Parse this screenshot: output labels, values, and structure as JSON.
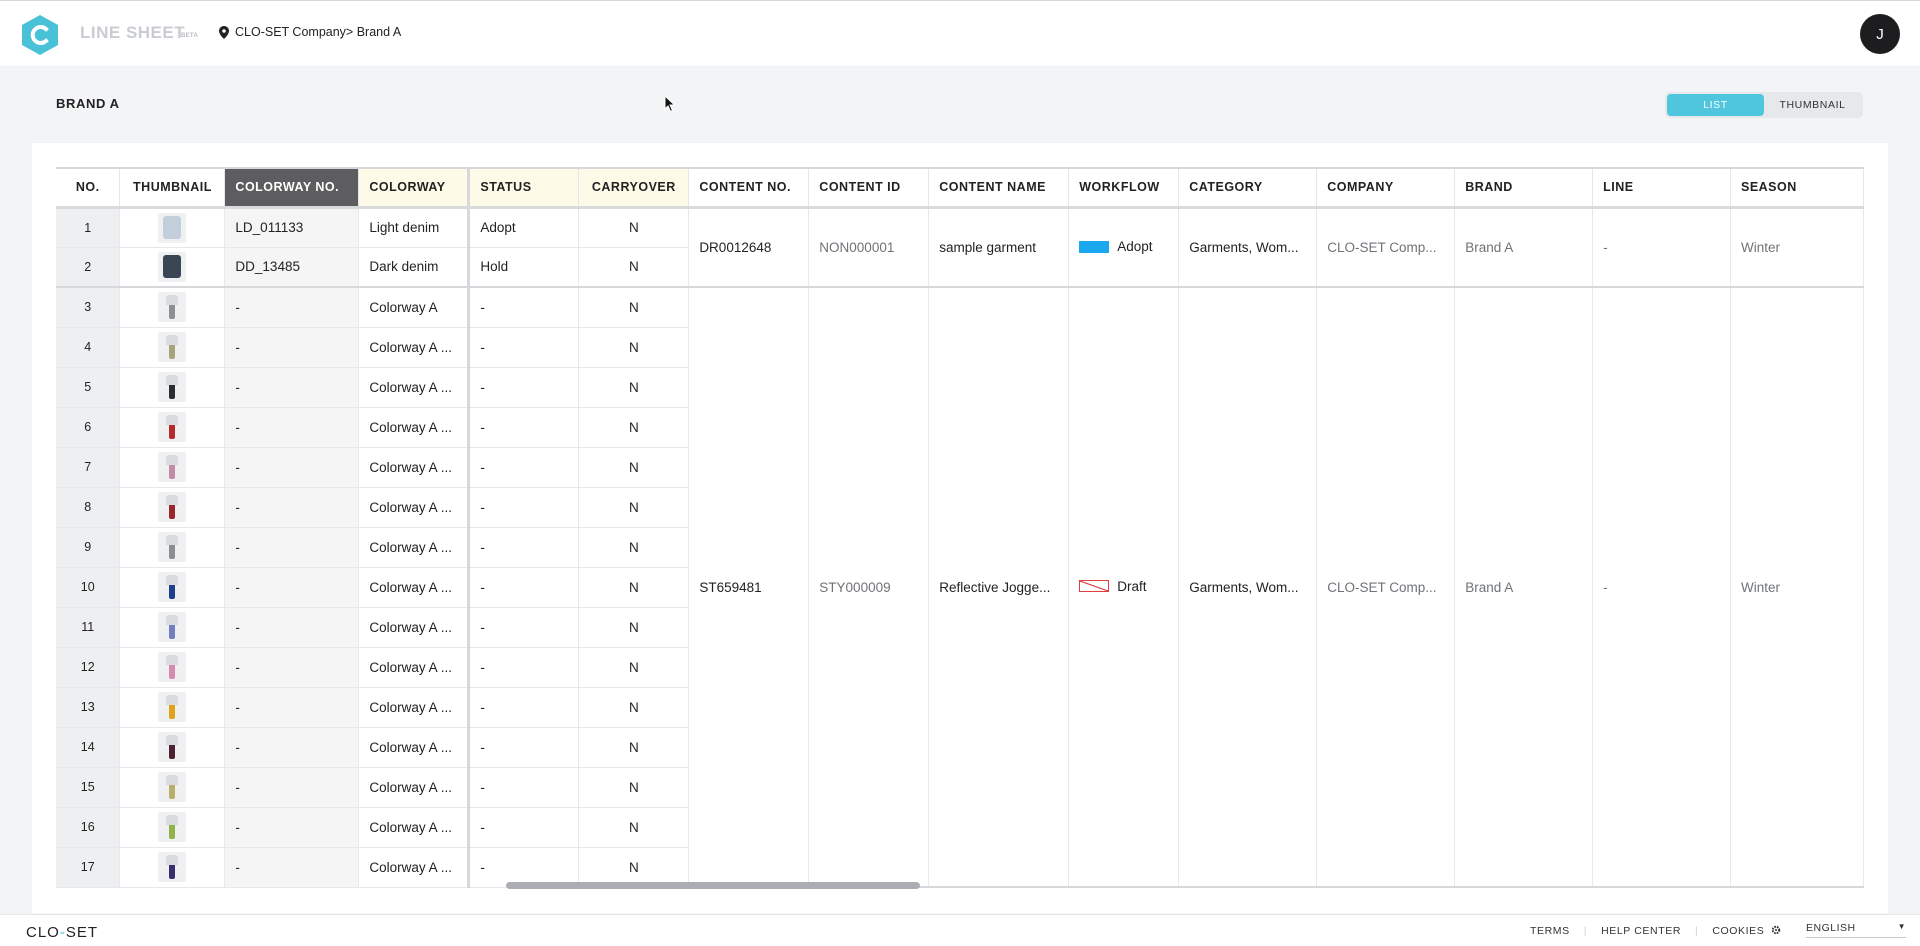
{
  "header": {
    "app_title": "LINE SHEET",
    "app_badge": "BETA",
    "breadcrumb": "CLO-SET Company> Brand A",
    "avatar_initial": "J"
  },
  "page": {
    "title": "BRAND A",
    "view_toggle": {
      "list": "LIST",
      "thumbnail": "THUMBNAIL",
      "selected": "LIST"
    }
  },
  "table": {
    "columns": [
      "NO.",
      "THUMBNAIL",
      "COLORWAY NO.",
      "COLORWAY",
      "STATUS",
      "CARRYOVER",
      "CONTENT NO.",
      "CONTENT ID",
      "CONTENT NAME",
      "WORKFLOW",
      "CATEGORY",
      "COMPANY",
      "BRAND",
      "LINE",
      "SEASON"
    ],
    "groups": [
      {
        "content_no": "DR0012648",
        "content_id": "NON000001",
        "content_name": "sample garment",
        "workflow": "Adopt",
        "workflow_color": "#1aa9ee",
        "category": "Garments, Wom...",
        "company": "CLO-SET Comp...",
        "brand": "Brand A",
        "line": "-",
        "season": "Winter"
      },
      {
        "content_no": "ST659481",
        "content_id": "STY000009",
        "content_name": "Reflective Jogge...",
        "workflow": "Draft",
        "workflow_color": "#e23d3d",
        "category": "Garments, Wom...",
        "company": "CLO-SET Comp...",
        "brand": "Brand A",
        "line": "-",
        "season": "Winter"
      }
    ],
    "rows": [
      {
        "no": "1",
        "thumb": "light-shirt",
        "colorway_no": "LD_011133",
        "colorway": "Light denim",
        "status": "Adopt",
        "carryover": "N"
      },
      {
        "no": "2",
        "thumb": "dark-shirt",
        "colorway_no": "DD_13485",
        "colorway": "Dark denim",
        "status": "Hold",
        "carryover": "N"
      },
      {
        "no": "3",
        "thumb": "#8c8f94",
        "colorway_no": "-",
        "colorway": "Colorway A",
        "status": "-",
        "carryover": "N"
      },
      {
        "no": "4",
        "thumb": "#a8a47a",
        "colorway_no": "-",
        "colorway": "Colorway A ...",
        "status": "-",
        "carryover": "N"
      },
      {
        "no": "5",
        "thumb": "#2c2d33",
        "colorway_no": "-",
        "colorway": "Colorway A ...",
        "status": "-",
        "carryover": "N"
      },
      {
        "no": "6",
        "thumb": "#b52a2a",
        "colorway_no": "-",
        "colorway": "Colorway A ...",
        "status": "-",
        "carryover": "N"
      },
      {
        "no": "7",
        "thumb": "#c58aa6",
        "colorway_no": "-",
        "colorway": "Colorway A ...",
        "status": "-",
        "carryover": "N"
      },
      {
        "no": "8",
        "thumb": "#9a2530",
        "colorway_no": "-",
        "colorway": "Colorway A ...",
        "status": "-",
        "carryover": "N"
      },
      {
        "no": "9",
        "thumb": "#8a8d91",
        "colorway_no": "-",
        "colorway": "Colorway A ...",
        "status": "-",
        "carryover": "N"
      },
      {
        "no": "10",
        "thumb": "#1f3f8a",
        "colorway_no": "-",
        "colorway": "Colorway A ...",
        "status": "-",
        "carryover": "N"
      },
      {
        "no": "11",
        "thumb": "#6f7fc2",
        "colorway_no": "-",
        "colorway": "Colorway A ...",
        "status": "-",
        "carryover": "N"
      },
      {
        "no": "12",
        "thumb": "#d88bb0",
        "colorway_no": "-",
        "colorway": "Colorway A ...",
        "status": "-",
        "carryover": "N"
      },
      {
        "no": "13",
        "thumb": "#e0a21b",
        "colorway_no": "-",
        "colorway": "Colorway A ...",
        "status": "-",
        "carryover": "N"
      },
      {
        "no": "14",
        "thumb": "#4a2230",
        "colorway_no": "-",
        "colorway": "Colorway A ...",
        "status": "-",
        "carryover": "N"
      },
      {
        "no": "15",
        "thumb": "#b8b06a",
        "colorway_no": "-",
        "colorway": "Colorway A ...",
        "status": "-",
        "carryover": "N"
      },
      {
        "no": "16",
        "thumb": "#8fb34a",
        "colorway_no": "-",
        "colorway": "Colorway A ...",
        "status": "-",
        "carryover": "N"
      },
      {
        "no": "17",
        "thumb": "#3b2e6e",
        "colorway_no": "-",
        "colorway": "Colorway A ...",
        "status": "-",
        "carryover": "N"
      }
    ]
  },
  "footer": {
    "logo_left": "CLO",
    "logo_dot": "-",
    "logo_right": "SET",
    "links": [
      "TERMS",
      "HELP CENTER",
      "COOKIES"
    ],
    "language": "ENGLISH"
  },
  "colors": {
    "accent": "#4fc6dd",
    "header_dark": "#5d5d60",
    "highlight": "#fdfbe7"
  }
}
